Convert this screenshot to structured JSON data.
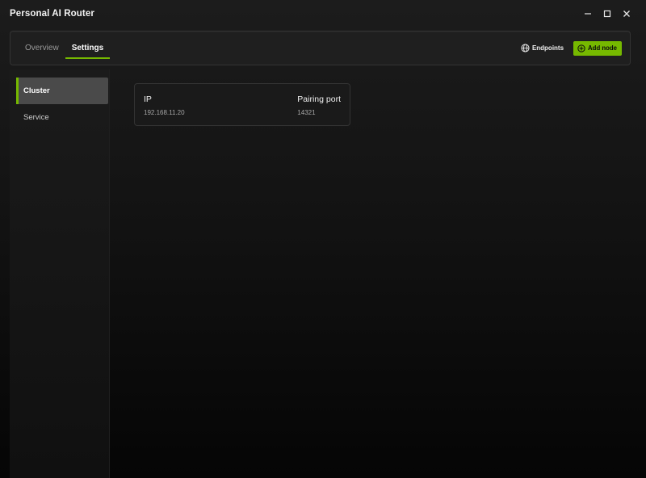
{
  "window": {
    "title": "Personal AI Router"
  },
  "nav": {
    "tabs": [
      {
        "label": "Overview",
        "active": false
      },
      {
        "label": "Settings",
        "active": true
      }
    ],
    "endpoints_label": "Endpoints",
    "add_node_label": "Add node"
  },
  "sidebar": {
    "items": [
      {
        "label": "Cluster",
        "active": true
      },
      {
        "label": "Service",
        "active": false
      }
    ]
  },
  "cluster": {
    "ip_label": "IP",
    "ip_value": "192.168.11.20",
    "port_label": "Pairing port",
    "port_value": "14321"
  },
  "colors": {
    "accent": "#76b900",
    "background": "#0c0c0c",
    "card": "#1a1a1a"
  },
  "icons": {
    "endpoints": "globe-icon",
    "add_node": "plus-circle-icon",
    "minimize": "minimize-icon",
    "maximize": "maximize-icon",
    "close": "close-icon"
  }
}
